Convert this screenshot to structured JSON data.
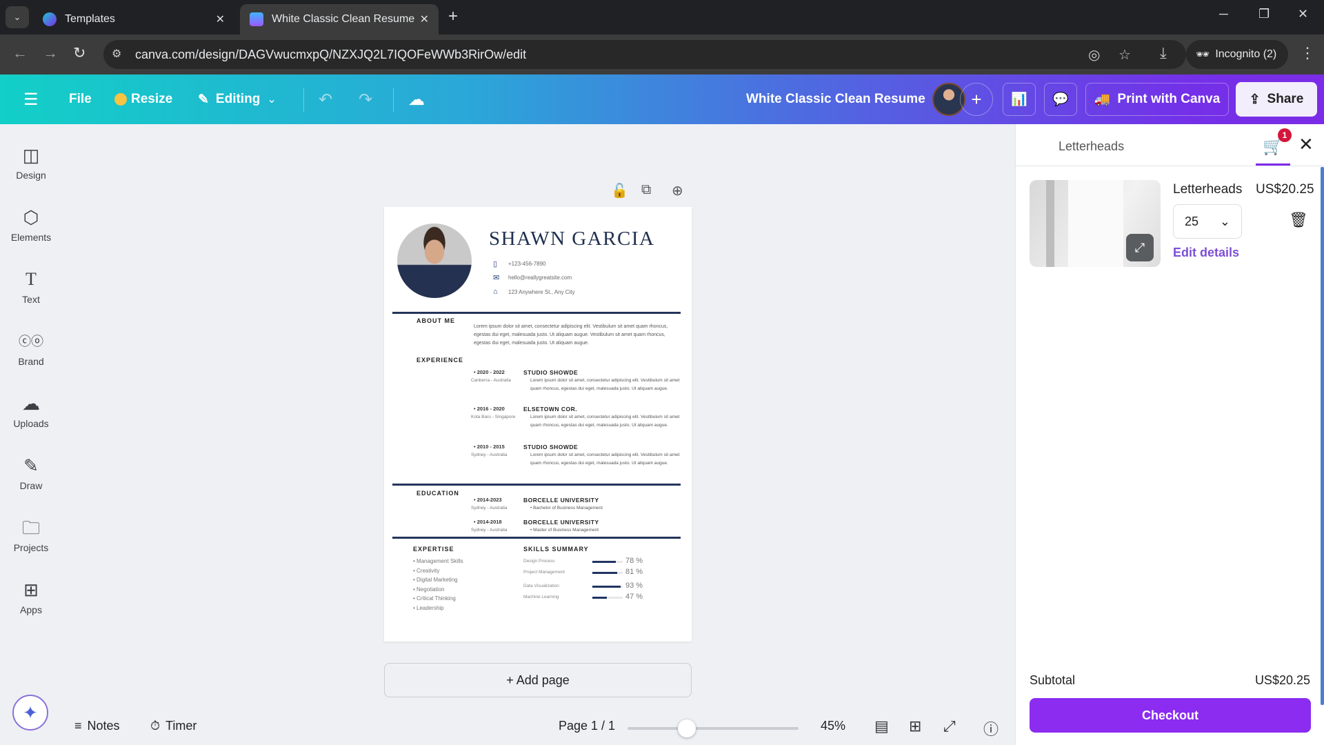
{
  "browser": {
    "tabs": [
      {
        "title": "Templates",
        "active": false
      },
      {
        "title": "White Classic Clean Resume - A",
        "active": true
      }
    ],
    "url": "canva.com/design/DAGVwucmxpQ/NZXJQ2L7IQOFeWWb3RirOw/edit",
    "incognito_label": "Incognito (2)"
  },
  "header": {
    "file": "File",
    "resize": "Resize",
    "editing": "Editing",
    "design_title": "White Classic Clean Resume",
    "print": "Print with Canva",
    "share": "Share"
  },
  "sidebar": {
    "items": [
      {
        "label": "Design",
        "icon": "layout-icon"
      },
      {
        "label": "Elements",
        "icon": "shapes-icon"
      },
      {
        "label": "Text",
        "icon": "text-icon"
      },
      {
        "label": "Brand",
        "icon": "brand-icon"
      },
      {
        "label": "Uploads",
        "icon": "cloud-upload-icon"
      },
      {
        "label": "Draw",
        "icon": "pen-icon"
      },
      {
        "label": "Projects",
        "icon": "folder-icon"
      },
      {
        "label": "Apps",
        "icon": "apps-icon"
      }
    ]
  },
  "resume": {
    "name": "SHAWN GARCIA",
    "phone": "+123-456-7890",
    "email": "hello@reallygreatsite.com",
    "address": "123 Anywhere St., Any City",
    "about_heading": "ABOUT ME",
    "about_text": "Lorem ipsum dolor sit amet, consectetur adipiscing elit. Vestibulum sit amet quam rhoncus, egestas dui eget, malesuada justo. Ut aliquam augue. Vestibulum sit amet quam rhoncus, egestas dui eget, malesuada justo. Ut aliquam augue.",
    "experience_heading": "EXPERIENCE",
    "experience": [
      {
        "years": "2020 - 2022",
        "location": "Canberra - Australia",
        "company": "STUDIO SHOWDE",
        "desc": "Lorem ipsum dolor sit amet, consectetur adipiscing elit. Vestibulum sit amet quam rhoncus, egestas dui eget, malesuada justo. Ut aliquam augue."
      },
      {
        "years": "2016 - 2020",
        "location": "Kota Baru - Singapore",
        "company": "ELSETOWN COR.",
        "desc": "Lorem ipsum dolor sit amet, consectetur adipiscing elit. Vestibulum sit amet quam rhoncus, egestas dui eget, malesuada justo. Ut aliquam augue."
      },
      {
        "years": "2010 - 2015",
        "location": "Sydney - Australia",
        "company": "STUDIO SHOWDE",
        "desc": "Lorem ipsum dolor sit amet, consectetur adipiscing elit. Vestibulum sit amet quam rhoncus, egestas dui eget, malesuada justo. Ut aliquam augue."
      }
    ],
    "education_heading": "EDUCATION",
    "education": [
      {
        "years": "2014-2023",
        "location": "Sydney - Australia",
        "school": "BORCELLE UNIVERSITY",
        "degree": "Bachelor of Business Management"
      },
      {
        "years": "2014-2018",
        "location": "Sydney - Australia",
        "school": "BORCELLE UNIVERSITY",
        "degree": "Master of Business Management"
      }
    ],
    "expertise_heading": "EXPERTISE",
    "expertise": [
      "Management Skills",
      "Creativity",
      "Digital Marketing",
      "Negotiation",
      "Critical Thinking",
      "Leadership"
    ],
    "skills_heading": "SKILLS SUMMARY",
    "skills": [
      {
        "name": "Design Process",
        "percent": 78,
        "label": "78 %"
      },
      {
        "name": "Project Management",
        "percent": 81,
        "label": "81 %"
      },
      {
        "name": "Data Visualization",
        "percent": 93,
        "label": "93 %"
      },
      {
        "name": "Machine Learning",
        "percent": 47,
        "label": "47 %"
      }
    ]
  },
  "canvas": {
    "add_page": "+ Add page"
  },
  "footer": {
    "notes": "Notes",
    "timer": "Timer",
    "page_indicator": "Page 1 / 1",
    "zoom_percent": 45,
    "zoom_label": "45%"
  },
  "cart_panel": {
    "title": "Letterheads",
    "badge_count": "1",
    "item": {
      "name": "Letterheads",
      "price": "US$20.25",
      "quantity": "25",
      "edit_details": "Edit details"
    },
    "subtotal_label": "Subtotal",
    "subtotal_value": "US$20.25",
    "checkout": "Checkout"
  }
}
